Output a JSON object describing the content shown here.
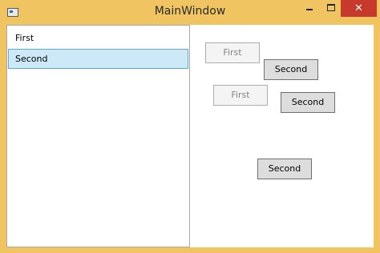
{
  "window": {
    "title": "MainWindow",
    "close_glyph": "✕"
  },
  "listbox": {
    "items": [
      {
        "label": "First",
        "selected": false
      },
      {
        "label": "Second",
        "selected": true
      }
    ]
  },
  "buttons": [
    {
      "label": "First",
      "enabled": false
    },
    {
      "label": "Second",
      "enabled": true
    },
    {
      "label": "First",
      "enabled": false
    },
    {
      "label": "Second",
      "enabled": true
    },
    {
      "label": "Second",
      "enabled": true
    }
  ],
  "colors": {
    "frame": "#f0c460",
    "close_button": "#c7392b",
    "selection_fill": "#cde8f7",
    "selection_border": "#5fa8d3"
  }
}
